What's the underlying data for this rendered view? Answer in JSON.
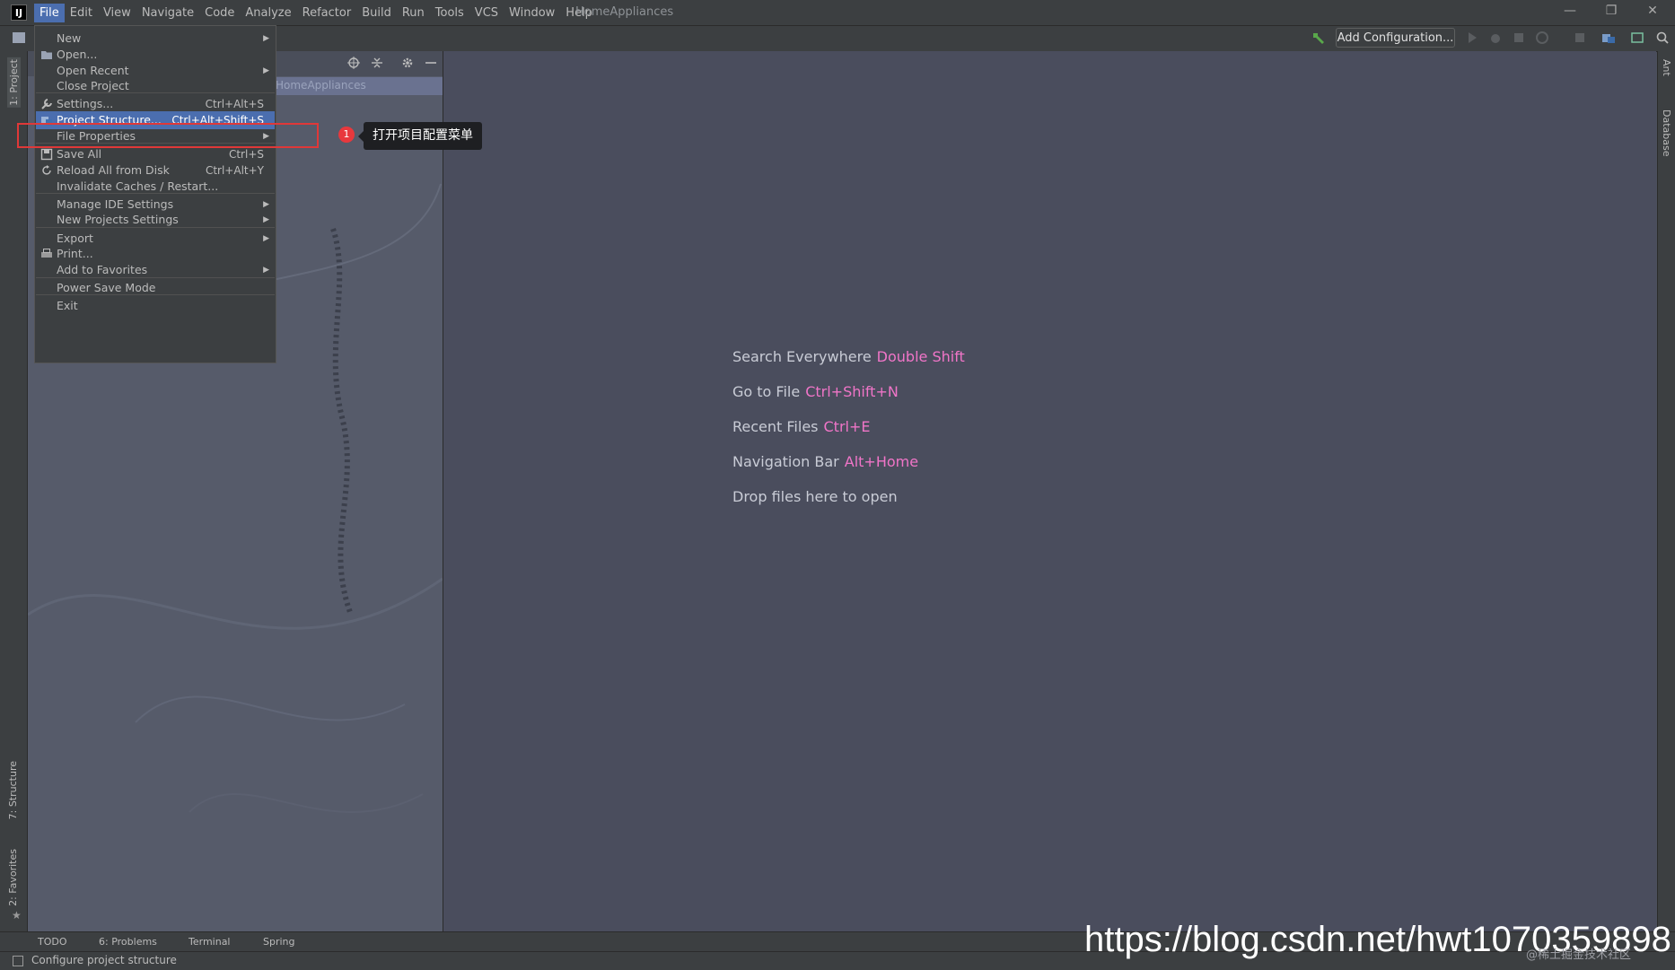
{
  "menubar": {
    "app_icon": "intellij-logo-icon",
    "items": [
      "File",
      "Edit",
      "View",
      "Navigate",
      "Code",
      "Analyze",
      "Refactor",
      "Build",
      "Run",
      "Tools",
      "VCS",
      "Window",
      "Help"
    ],
    "active_item": "File",
    "window_title": "HomeAppliances",
    "window_controls": [
      "minimize-icon",
      "restore-icon",
      "close-icon"
    ]
  },
  "toolbar": {
    "add_configuration": "Add Configuration...",
    "icons": [
      "hammer-icon",
      "run-icon",
      "debug-icon",
      "coverage-icon",
      "profile-icon",
      "stop-icon",
      "project-structure-icon",
      "sdk-icon",
      "search-icon"
    ]
  },
  "left_strip": {
    "project_tab": "1: Project",
    "structure_tab": "7: Structure",
    "favorites_tab": "2: Favorites"
  },
  "right_strip": {
    "ant_tab": "Ant",
    "database_tab": "Database"
  },
  "project_panel": {
    "root": "HomeAppliances"
  },
  "file_menu": {
    "items": [
      {
        "label": "New",
        "shortcut": "",
        "submenu": true,
        "icon": ""
      },
      {
        "label": "Open...",
        "shortcut": "",
        "submenu": false,
        "icon": "folder-icon"
      },
      {
        "label": "Open Recent",
        "shortcut": "",
        "submenu": true,
        "icon": ""
      },
      {
        "label": "Close Project",
        "shortcut": "",
        "submenu": false,
        "icon": ""
      },
      {
        "label": "Settings...",
        "shortcut": "Ctrl+Alt+S",
        "submenu": false,
        "icon": "wrench-icon"
      },
      {
        "label": "Project Structure...",
        "shortcut": "Ctrl+Alt+Shift+S",
        "submenu": false,
        "icon": "project-structure-icon"
      },
      {
        "label": "File Properties",
        "shortcut": "",
        "submenu": true,
        "icon": ""
      },
      {
        "label": "Save All",
        "shortcut": "Ctrl+S",
        "submenu": false,
        "icon": "save-icon"
      },
      {
        "label": "Reload All from Disk",
        "shortcut": "Ctrl+Alt+Y",
        "submenu": false,
        "icon": "reload-icon"
      },
      {
        "label": "Invalidate Caches / Restart...",
        "shortcut": "",
        "submenu": false,
        "icon": ""
      },
      {
        "label": "Manage IDE Settings",
        "shortcut": "",
        "submenu": true,
        "icon": ""
      },
      {
        "label": "New Projects Settings",
        "shortcut": "",
        "submenu": true,
        "icon": ""
      },
      {
        "label": "Export",
        "shortcut": "",
        "submenu": true,
        "icon": ""
      },
      {
        "label": "Print...",
        "shortcut": "",
        "submenu": false,
        "icon": "print-icon"
      },
      {
        "label": "Add to Favorites",
        "shortcut": "",
        "submenu": true,
        "icon": ""
      },
      {
        "label": "Power Save Mode",
        "shortcut": "",
        "submenu": false,
        "icon": ""
      },
      {
        "label": "Exit",
        "shortcut": "",
        "submenu": false,
        "icon": ""
      }
    ],
    "selected": "Project Structure..."
  },
  "annotation": {
    "number": "1",
    "text": "打开项目配置菜单",
    "color": "#e03838"
  },
  "editor_hints": [
    {
      "text": "Search Everywhere",
      "key": "Double Shift"
    },
    {
      "text": "Go to File",
      "key": "Ctrl+Shift+N"
    },
    {
      "text": "Recent Files",
      "key": "Ctrl+E"
    },
    {
      "text": "Navigation Bar",
      "key": "Alt+Home"
    },
    {
      "text": "Drop files here to open",
      "key": ""
    }
  ],
  "bottom_tabs": [
    "TODO",
    "6: Problems",
    "Terminal",
    "Spring"
  ],
  "status": {
    "text": "Configure project structure"
  },
  "watermark": {
    "url": "https://blog.csdn.net/hwt1070359898",
    "sub": "@稀土掘金技术社区"
  },
  "colors": {
    "accent": "#4b6eaf",
    "hint_key": "#f075c8",
    "highlight": "#e03838"
  }
}
